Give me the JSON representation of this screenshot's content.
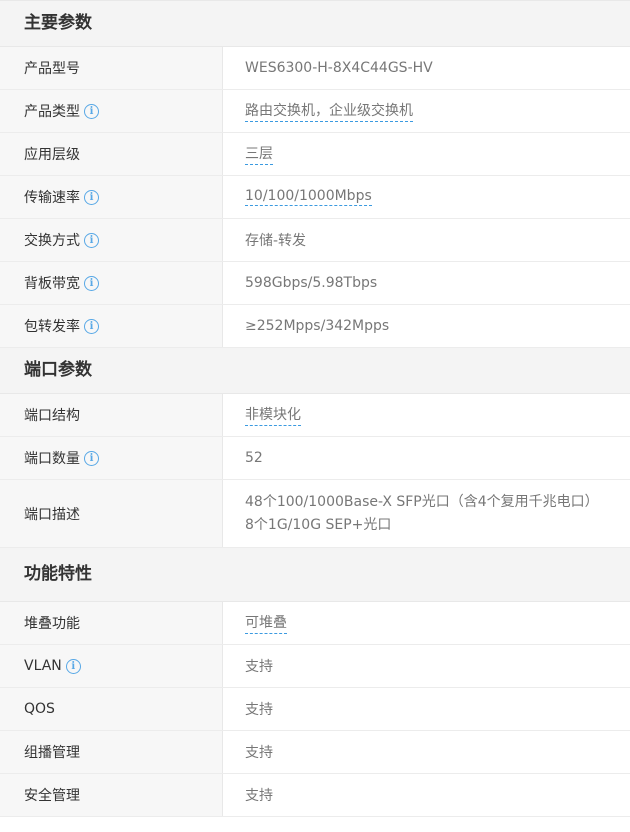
{
  "sections": {
    "main": {
      "title": "主要参数",
      "rows": [
        {
          "label": "产品型号",
          "value": "WES6300-H-8X4C44GS-HV"
        },
        {
          "label": "产品类型",
          "value": "路由交换机，企业级交换机"
        },
        {
          "label": "应用层级",
          "value": "三层"
        },
        {
          "label": "传输速率",
          "value": "10/100/1000Mbps"
        },
        {
          "label": "交换方式",
          "value": "存储-转发"
        },
        {
          "label": "背板带宽",
          "value": "598Gbps/5.98Tbps"
        },
        {
          "label": "包转发率",
          "value": "≥252Mpps/342Mpps"
        }
      ]
    },
    "port": {
      "title": "端口参数",
      "rows": [
        {
          "label": "端口结构",
          "value": "非模块化"
        },
        {
          "label": "端口数量",
          "value": "52"
        },
        {
          "label": "端口描述",
          "value_line1": "48个100/1000Base-X SFP光口（含4个复用千兆电口）",
          "value_line2": "8个1G/10G SEP+光口"
        }
      ]
    },
    "feature": {
      "title": "功能特性",
      "rows": [
        {
          "label": "堆叠功能",
          "value": "可堆叠"
        },
        {
          "label": "VLAN",
          "value": "支持"
        },
        {
          "label": "QOS",
          "value": "支持"
        },
        {
          "label": "组播管理",
          "value": "支持"
        },
        {
          "label": "安全管理",
          "value": "支持"
        }
      ]
    }
  },
  "info_icon_glyph": "i",
  "colors": {
    "link_underline": "#3b9ae0",
    "info_icon": "#58a8e6",
    "section_bg": "#f4f4f4"
  }
}
